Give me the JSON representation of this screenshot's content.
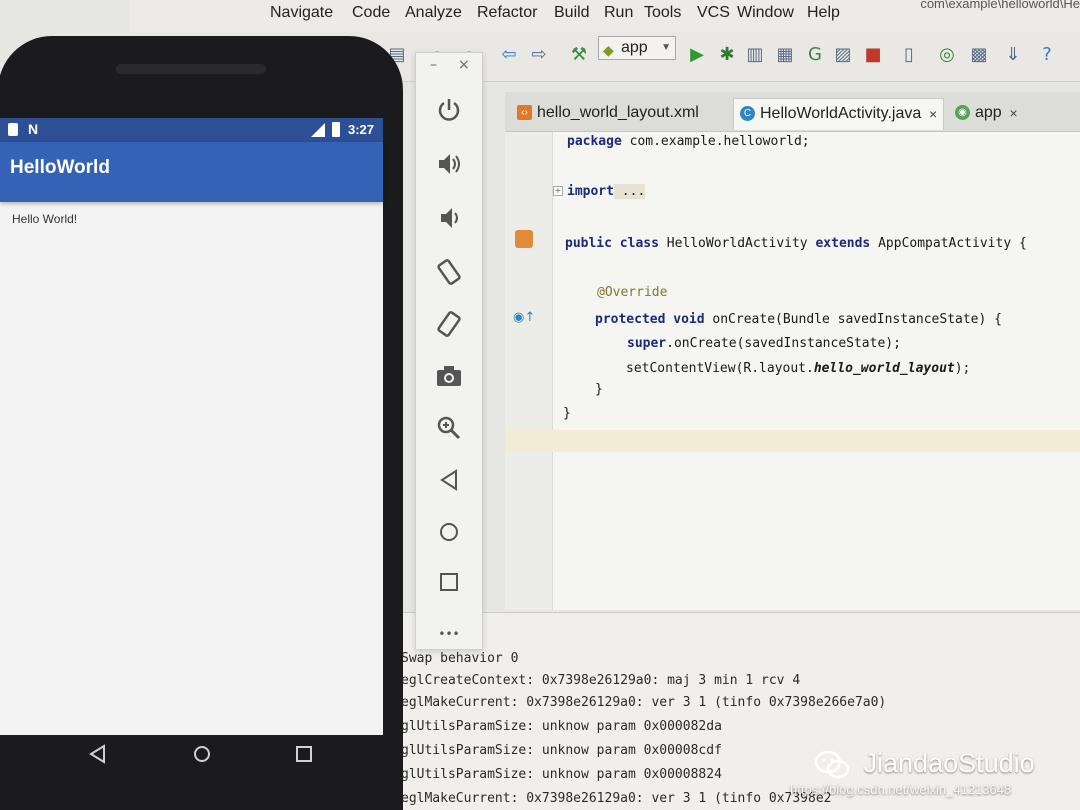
{
  "ide": {
    "menu": [
      "Navigate",
      "Code",
      "Analyze",
      "Refactor",
      "Build",
      "Run",
      "Tools",
      "VCS",
      "Window",
      "Help"
    ],
    "title_path": "com\\example\\helloworld\\He",
    "run_config": "app",
    "tabs": [
      {
        "label": "hello_world_layout.xml",
        "icon": "xml-file-icon",
        "color": "#e07a2a"
      },
      {
        "label": "HelloWorldActivity.java",
        "icon": "java-class-icon",
        "color": "#2e86c1"
      },
      {
        "label": "app",
        "icon": "gradle-module-icon",
        "color": "#5aa05a"
      }
    ],
    "code": {
      "line1_kw": "package",
      "line1_rest": " com.example.helloworld;",
      "line2_kw": "import",
      "line2_rest": " ...",
      "line3_kw1": "public class",
      "line3_name": " HelloWorldActivity ",
      "line3_kw2": "extends",
      "line3_rest": " AppCompatActivity {",
      "line4": "@Override",
      "line5_kw": "protected void",
      "line5_rest": " onCreate(Bundle savedInstanceState) {",
      "line6_kw": "super",
      "line6_rest": ".onCreate(savedInstanceState);",
      "line7_a": "setContentView(R.layout.",
      "line7_b": "hello_world_layout",
      "line7_c": ");",
      "line8": "}",
      "line9": "}"
    },
    "console": [
      "Swap behavior 0",
      "eglCreateContext: 0x7398e26129a0: maj 3 min 1 rcv 4",
      "eglMakeCurrent: 0x7398e26129a0: ver 3 1 (tinfo 0x7398e266e7a0)",
      "glUtilsParamSize: unknow param 0x000082da",
      "glUtilsParamSize: unknow param 0x00008cdf",
      "glUtilsParamSize: unknow param 0x00008824",
      "eglMakeCurrent: 0x7398e26129a0: ver 3 1 (tinfo 0x7398e2"
    ]
  },
  "emulator": {
    "minimize": "–",
    "close": "×",
    "more": "•••"
  },
  "phone": {
    "time": "3:27",
    "app_title": "HelloWorld",
    "content": "Hello World!"
  },
  "watermark": {
    "brand": "JiandaoStudio",
    "url": "https://blog.csdn.net/weixin_41213648"
  }
}
